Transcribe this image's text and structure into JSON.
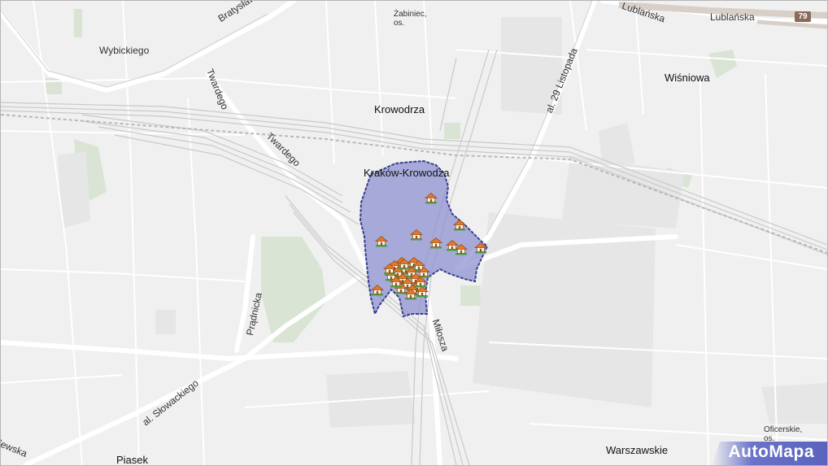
{
  "map": {
    "place_labels": {
      "krowodrza": "Krowodrza",
      "krakow_krowodrza": "Kraków-Krowodza",
      "wisniowa": "Wiśniowa",
      "warszawskie": "Warszawskie",
      "piasek": "Piasek",
      "zabiniec_line1": "Żabiniec,",
      "zabiniec_line2": "os.",
      "oficerskie_line1": "Oficerskie,",
      "oficerskie_line2": "os."
    },
    "street_labels": {
      "wybickiego": "Wybickiego",
      "bratyslawska": "Bratysławska",
      "twardego_1": "Twardego",
      "twardego_2": "Twardego",
      "pradnicka": "Prądnicka",
      "slowackiego": "al. Słowackiego",
      "listopada": "al. 29 Listopada",
      "milosza": "Miłosza",
      "lublanska_1": "Lublańska",
      "lublanska_2": "Lublańska",
      "warszawska_fragment": "lewska"
    },
    "route_badge": "79",
    "markers": {
      "icon": "house-icon",
      "count": 30
    },
    "highlight_color": "#8a8fd0",
    "highlight_border": "#3a3f8f"
  },
  "logo": {
    "text": "AutoMapa"
  }
}
